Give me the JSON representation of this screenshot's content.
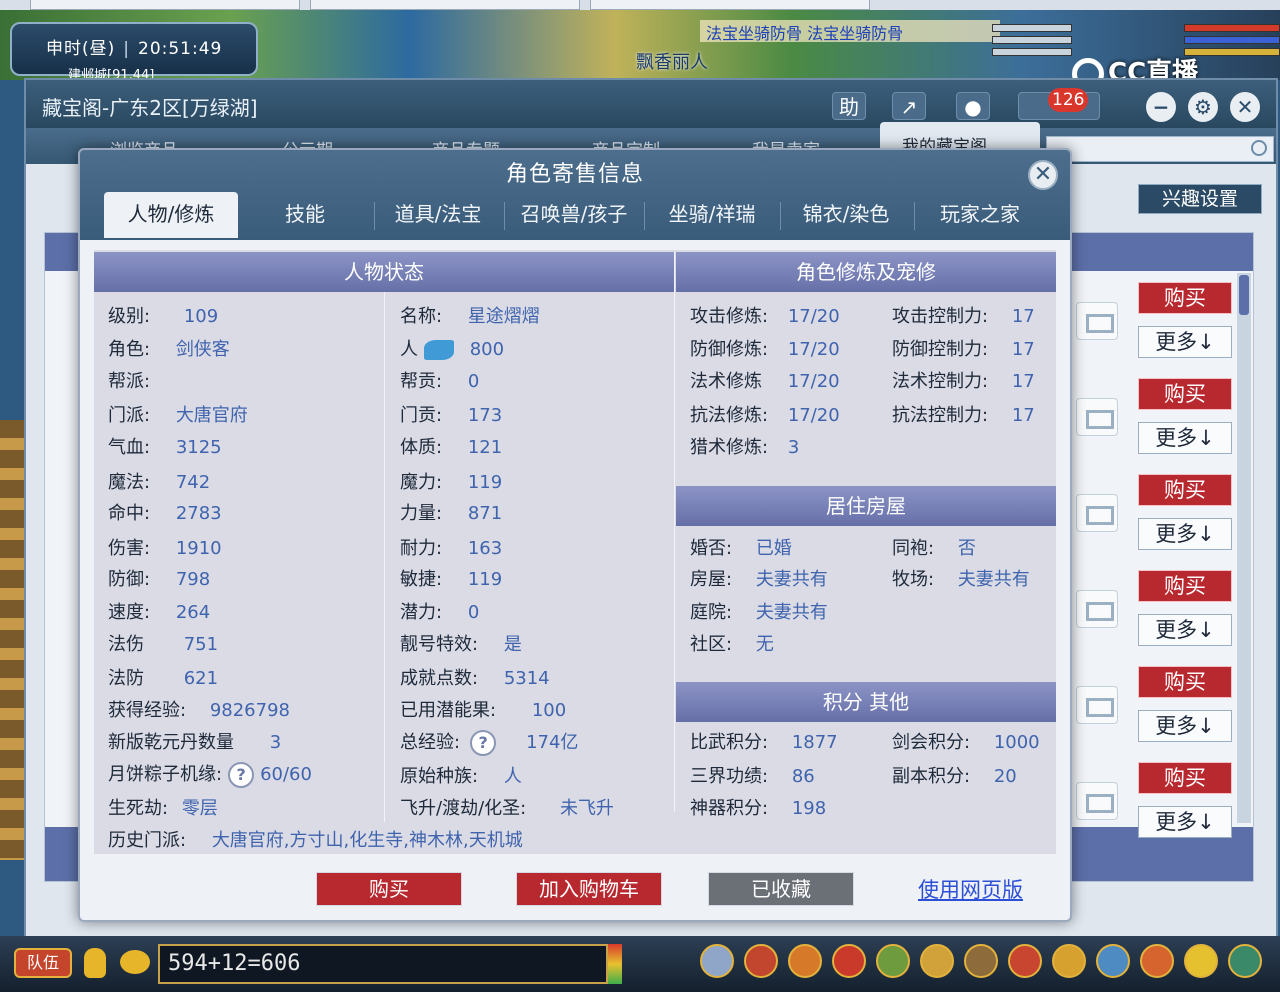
{
  "game": {
    "time_label": "申时(昼)",
    "clock": "20:51:49",
    "location": "建邺城[91,44]",
    "scroll_text": "法宝坐骑防骨 法宝坐骑防骨",
    "character_name": "飘香丽人",
    "stream_logo": "CC直播",
    "team_label": "队伍",
    "chat_text": "594+12=606"
  },
  "cbg": {
    "window_title": "藏宝阁-广东2区[万绿湖]",
    "toolbar": {
      "help_label": "助",
      "cart_count": "126"
    },
    "nav": [
      "浏览商品",
      "公示期",
      "商品专题",
      "商品定制",
      "我是卖家",
      "我的藏宝阁"
    ],
    "interest_button": "兴趣设置",
    "buy_label": "购买",
    "more_label": "更多↓",
    "bottom_left_char": "钱"
  },
  "modal": {
    "title": "角色寄售信息",
    "tabs": [
      "人物/修炼",
      "技能",
      "道具/法宝",
      "召唤兽/孩子",
      "坐骑/祥瑞",
      "锦衣/染色",
      "玩家之家"
    ],
    "status_header": "人物状态",
    "cultivation_header": "角色修炼及宠修",
    "house_header": "居住房屋",
    "score_header": "积分 其他",
    "left_col": [
      {
        "k": "级别:",
        "v": "109"
      },
      {
        "k": "角色:",
        "v": "剑侠客"
      },
      {
        "k": "帮派:",
        "v": ""
      },
      {
        "k": "门派:",
        "v": "大唐官府"
      },
      {
        "k": "气血:",
        "v": "3125"
      },
      {
        "k": "魔法:",
        "v": "742"
      },
      {
        "k": "命中:",
        "v": "2783"
      },
      {
        "k": "伤害:",
        "v": "1910"
      },
      {
        "k": "防御:",
        "v": "798"
      },
      {
        "k": "速度:",
        "v": "264"
      },
      {
        "k": "法伤",
        "v": "751"
      },
      {
        "k": "法防",
        "v": "621"
      },
      {
        "k": "获得经验:",
        "v": "9826798"
      },
      {
        "k": "新版乾元丹数量",
        "v": "3"
      },
      {
        "k": "月饼粽子机缘:",
        "v": "60/60"
      },
      {
        "k": "生死劫:",
        "v": "零层"
      }
    ],
    "mid_col": [
      {
        "k": "名称:",
        "v": "星途熠熠"
      },
      {
        "k": "人",
        "v": "800"
      },
      {
        "k": "帮贡:",
        "v": "0"
      },
      {
        "k": "门贡:",
        "v": "173"
      },
      {
        "k": "体质:",
        "v": "121"
      },
      {
        "k": "魔力:",
        "v": "119"
      },
      {
        "k": "力量:",
        "v": "871"
      },
      {
        "k": "耐力:",
        "v": "163"
      },
      {
        "k": "敏捷:",
        "v": "119"
      },
      {
        "k": "潜力:",
        "v": "0"
      },
      {
        "k": "靓号特效:",
        "v": "是"
      },
      {
        "k": "成就点数:",
        "v": "5314"
      },
      {
        "k": "已用潜能果:",
        "v": "100"
      },
      {
        "k": "总经验:",
        "v": "174亿"
      },
      {
        "k": "原始种族:",
        "v": "人"
      },
      {
        "k": "飞升/渡劫/化圣:",
        "v": "未飞升"
      }
    ],
    "history_label": "历史门派:",
    "history_value": "大唐官府,方寸山,化生寺,神木林,天机城",
    "cultivation": [
      {
        "k1": "攻击修炼:",
        "v1": "17/20",
        "k2": "攻击控制力:",
        "v2": "17"
      },
      {
        "k1": "防御修炼:",
        "v1": "17/20",
        "k2": "防御控制力:",
        "v2": "17"
      },
      {
        "k1": "法术修炼",
        "v1": "17/20",
        "k2": "法术控制力:",
        "v2": "17"
      },
      {
        "k1": "抗法修炼:",
        "v1": "17/20",
        "k2": "抗法控制力:",
        "v2": "17"
      },
      {
        "k1": "猎术修炼:",
        "v1": "3",
        "k2": "",
        "v2": ""
      }
    ],
    "house": [
      {
        "k1": "婚否:",
        "v1": "已婚",
        "k2": "同袍:",
        "v2": "否"
      },
      {
        "k1": "房屋:",
        "v1": "夫妻共有",
        "k2": "牧场:",
        "v2": "夫妻共有"
      },
      {
        "k1": "庭院:",
        "v1": "夫妻共有",
        "k2": "",
        "v2": ""
      },
      {
        "k1": "社区:",
        "v1": "无",
        "k2": "",
        "v2": ""
      }
    ],
    "scores": [
      {
        "k1": "比武积分:",
        "v1": "1877",
        "k2": "剑会积分:",
        "v2": "1000"
      },
      {
        "k1": "三界功绩:",
        "v1": "86",
        "k2": "副本积分:",
        "v2": "20"
      },
      {
        "k1": "神器积分:",
        "v1": "198",
        "k2": "",
        "v2": ""
      }
    ],
    "help_glyph": "?",
    "buttons": {
      "buy": "购买",
      "add_cart": "加入购物车",
      "favorited": "已收藏",
      "web_version": "使用网页版"
    }
  },
  "colors": {
    "accent_red": "#b8292f",
    "header_purple": "#6670a8",
    "value_blue": "#3f64ad",
    "link_blue": "#2c4fd6"
  }
}
